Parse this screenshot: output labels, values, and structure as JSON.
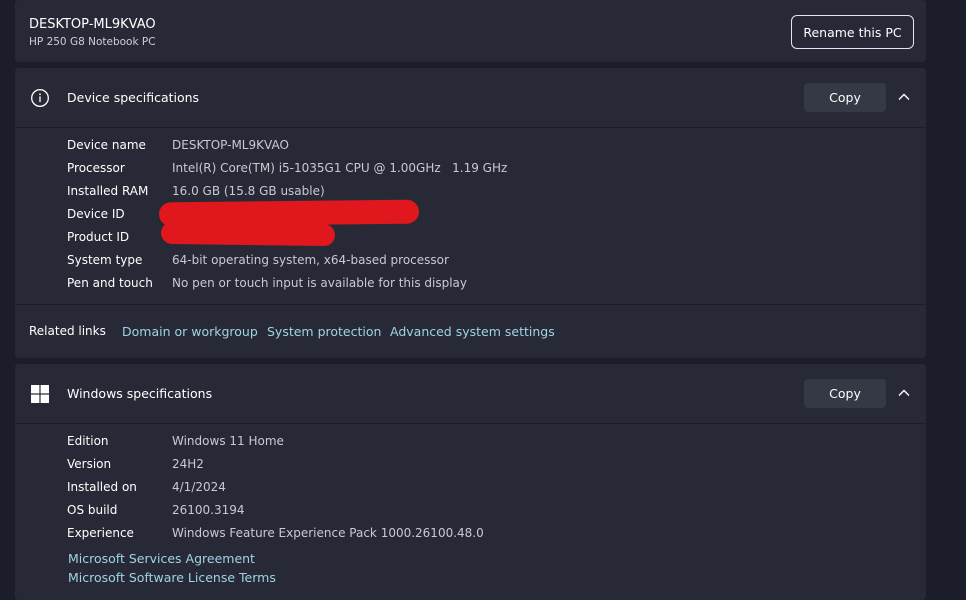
{
  "pc": {
    "name": "DESKTOP-ML9KVAO",
    "model": "HP 250 G8 Notebook PC",
    "rename_label": "Rename this PC"
  },
  "device_specs": {
    "title": "Device specifications",
    "copy_label": "Copy",
    "rows": [
      {
        "label": "Device name",
        "value": "DESKTOP-ML9KVAO"
      },
      {
        "label": "Processor",
        "value": "Intel(R) Core(TM) i5-1035G1 CPU @ 1.00GHz   1.19 GHz"
      },
      {
        "label": "Installed RAM",
        "value": "16.0 GB (15.8 GB usable)"
      },
      {
        "label": "Device ID",
        "value": ""
      },
      {
        "label": "Product ID",
        "value": ""
      },
      {
        "label": "System type",
        "value": "64-bit operating system, x64-based processor"
      },
      {
        "label": "Pen and touch",
        "value": "No pen or touch input is available for this display"
      }
    ]
  },
  "related_links": {
    "label": "Related links",
    "links": [
      "Domain or workgroup",
      "System protection",
      "Advanced system settings"
    ]
  },
  "windows_specs": {
    "title": "Windows specifications",
    "copy_label": "Copy",
    "rows": [
      {
        "label": "Edition",
        "value": "Windows 11 Home"
      },
      {
        "label": "Version",
        "value": "24H2"
      },
      {
        "label": "Installed on",
        "value": "4/1/2024"
      },
      {
        "label": "OS build",
        "value": "26100.3194"
      },
      {
        "label": "Experience",
        "value": "Windows Feature Experience Pack 1000.26100.48.0"
      }
    ],
    "links": [
      "Microsoft Services Agreement",
      "Microsoft Software License Terms"
    ]
  },
  "colors": {
    "background": "#1b1d2a",
    "card": "#272a36",
    "link": "#9fd3e4",
    "redaction": "#e0171c"
  },
  "icons": {
    "device_specs": "info-icon",
    "windows_specs": "windows-logo-icon",
    "collapse": "chevron-up-icon"
  }
}
